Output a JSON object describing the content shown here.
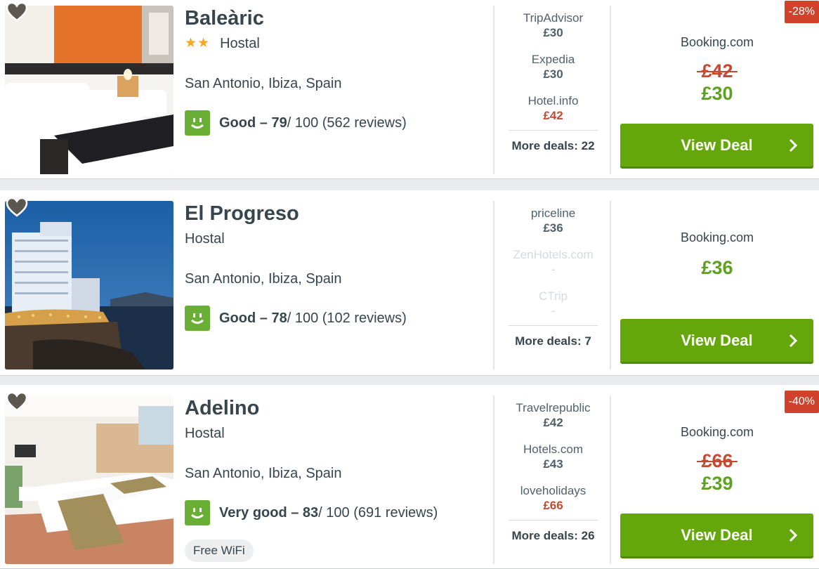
{
  "hotels": [
    {
      "name": "Baleàric",
      "stars": "★★",
      "type": "Hostal",
      "location": "San Antonio, Ibiza, Spain",
      "rating_label": "Good – 79",
      "rating_rest": " / 100 (562 reviews)",
      "deals": [
        {
          "name": "TripAdvisor",
          "price": "£30"
        },
        {
          "name": "Expedia",
          "price": "£30"
        },
        {
          "name": "Hotel.info",
          "price": "£42"
        }
      ],
      "more_deals": "More deals: 22",
      "provider": "Booking.com",
      "old_price": "£42",
      "price": "£30",
      "button": "View Deal",
      "discount": "-28%"
    },
    {
      "name": "El Progreso",
      "type": "Hostal",
      "location": "San Antonio, Ibiza, Spain",
      "rating_label": "Good – 78",
      "rating_rest": " / 100 (102 reviews)",
      "deals": [
        {
          "name": "priceline",
          "price": "£36"
        },
        {
          "name": "ZenHotels.com",
          "price": "-"
        },
        {
          "name": "CTrip",
          "price": "-"
        }
      ],
      "more_deals": "More deals: 7",
      "provider": "Booking.com",
      "price": "£36",
      "button": "View Deal"
    },
    {
      "name": "Adelino",
      "type": "Hostal",
      "location": "San Antonio, Ibiza, Spain",
      "rating_label": "Very good – 83",
      "rating_rest": " / 100 (691 reviews)",
      "amenity": "Free WiFi",
      "deals": [
        {
          "name": "Travelrepublic",
          "price": "£42"
        },
        {
          "name": "Hotels.com",
          "price": "£43"
        },
        {
          "name": "loveholidays",
          "price": "£66"
        }
      ],
      "more_deals": "More deals: 26",
      "provider": "Booking.com",
      "old_price": "£66",
      "price": "£39",
      "button": "View Deal",
      "discount": "-40%"
    }
  ],
  "colors": {
    "accent_green": "#65a70b",
    "price_green": "#5ea11f",
    "price_red": "#c64932",
    "rating_green": "#6aaf35",
    "discount_red": "#d1422c",
    "star_orange": "#f5a623"
  },
  "icons": {
    "favorite": "heart-icon",
    "rating": "smiley-face-icon",
    "button_arrow": "chevron-right-icon"
  }
}
